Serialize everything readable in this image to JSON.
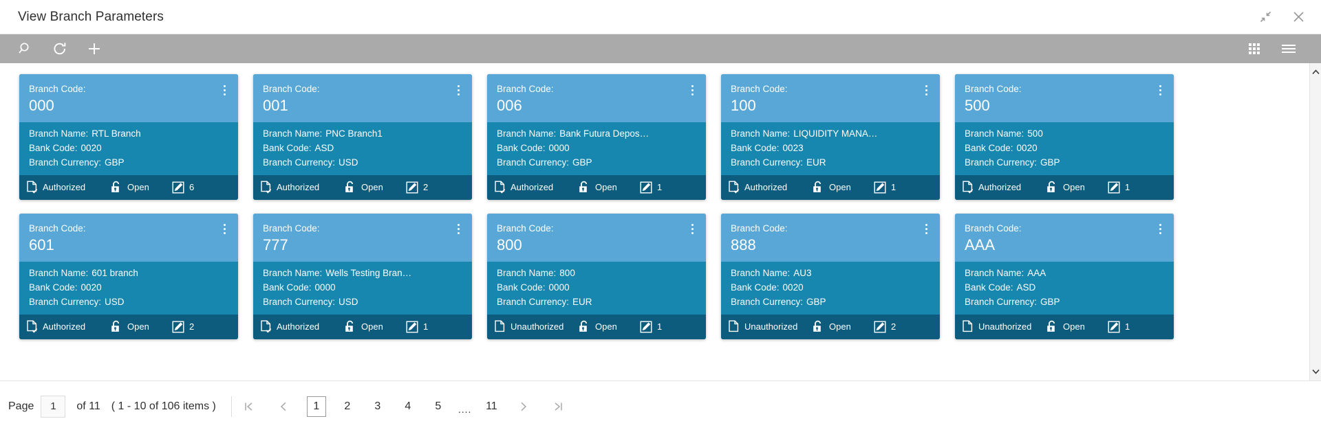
{
  "window": {
    "title": "View Branch Parameters",
    "actions": [
      {
        "name": "collapse-icon",
        "label": "Collapse"
      },
      {
        "name": "close-icon",
        "label": "Close"
      }
    ]
  },
  "toolbar": {
    "left": [
      {
        "name": "search-icon",
        "label": "Search"
      },
      {
        "name": "refresh-icon",
        "label": "Refresh"
      },
      {
        "name": "add-icon",
        "label": "Add"
      }
    ],
    "right": [
      {
        "name": "grid-view-icon",
        "label": "Tile View"
      },
      {
        "name": "menu-icon",
        "label": "Menu"
      }
    ]
  },
  "card_labels": {
    "code": "Branch Code:",
    "name": "Branch Name:",
    "bank": "Bank Code:",
    "currency": "Branch Currency:"
  },
  "cards": [
    {
      "code": "000",
      "name": "RTL Branch",
      "bank": "0020",
      "currency": "GBP",
      "status": "Authorized",
      "lock": "Open",
      "edits": "6"
    },
    {
      "code": "001",
      "name": "PNC Branch1",
      "bank": "ASD",
      "currency": "USD",
      "status": "Authorized",
      "lock": "Open",
      "edits": "2"
    },
    {
      "code": "006",
      "name": "Bank Futura Depos…",
      "bank": "0000",
      "currency": "GBP",
      "status": "Authorized",
      "lock": "Open",
      "edits": "1"
    },
    {
      "code": "100",
      "name": "LIQUIDITY MANA…",
      "bank": "0023",
      "currency": "EUR",
      "status": "Authorized",
      "lock": "Open",
      "edits": "1"
    },
    {
      "code": "500",
      "name": "500",
      "bank": "0020",
      "currency": "GBP",
      "status": "Authorized",
      "lock": "Open",
      "edits": "1"
    },
    {
      "code": "601",
      "name": "601 branch",
      "bank": "0020",
      "currency": "USD",
      "status": "Authorized",
      "lock": "Open",
      "edits": "2"
    },
    {
      "code": "777",
      "name": "Wells Testing Bran…",
      "bank": "0000",
      "currency": "USD",
      "status": "Authorized",
      "lock": "Open",
      "edits": "1"
    },
    {
      "code": "800",
      "name": "800",
      "bank": "0000",
      "currency": "EUR",
      "status": "Unauthorized",
      "lock": "Open",
      "edits": "1"
    },
    {
      "code": "888",
      "name": "AU3",
      "bank": "0020",
      "currency": "GBP",
      "status": "Unauthorized",
      "lock": "Open",
      "edits": "2"
    },
    {
      "code": "AAA",
      "name": "AAA",
      "bank": "ASD",
      "currency": "GBP",
      "status": "Unauthorized",
      "lock": "Open",
      "edits": "1"
    }
  ],
  "pagination": {
    "page_label": "Page",
    "page_value": "1",
    "of_text": "of 11",
    "items_text": "( 1 - 10 of 106 items )",
    "first_label": "K",
    "prev_label": "‹",
    "next_label": "›",
    "last_label": "Ʞ",
    "pages": [
      "1",
      "2",
      "3",
      "4",
      "5"
    ],
    "ellipsis": "....",
    "last_page": "11",
    "active_page": "1"
  },
  "colors": {
    "card_header": "#58a7d6",
    "card_body": "#1787b0",
    "card_footer": "#0d5c7e",
    "toolbar": "#aaaaaa"
  }
}
